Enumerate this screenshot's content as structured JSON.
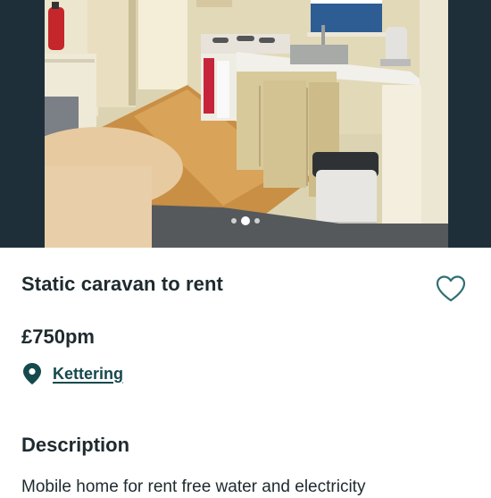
{
  "listing": {
    "title": "Static caravan to rent",
    "price": "£750pm",
    "location": "Kettering",
    "description_heading": "Description",
    "description_text": "Mobile home for rent free water and electricity"
  },
  "gallery": {
    "photo_subject": "caravan kitchen interior",
    "image_count_dots": 3,
    "active_dot": 1
  },
  "icons": {
    "favourite": "heart-outline-icon",
    "location": "map-pin-icon"
  },
  "colors": {
    "gallery_background": "#1f2f3a",
    "text": "#1e2a2e",
    "link": "#16494d",
    "heart": "#2f6f72"
  }
}
